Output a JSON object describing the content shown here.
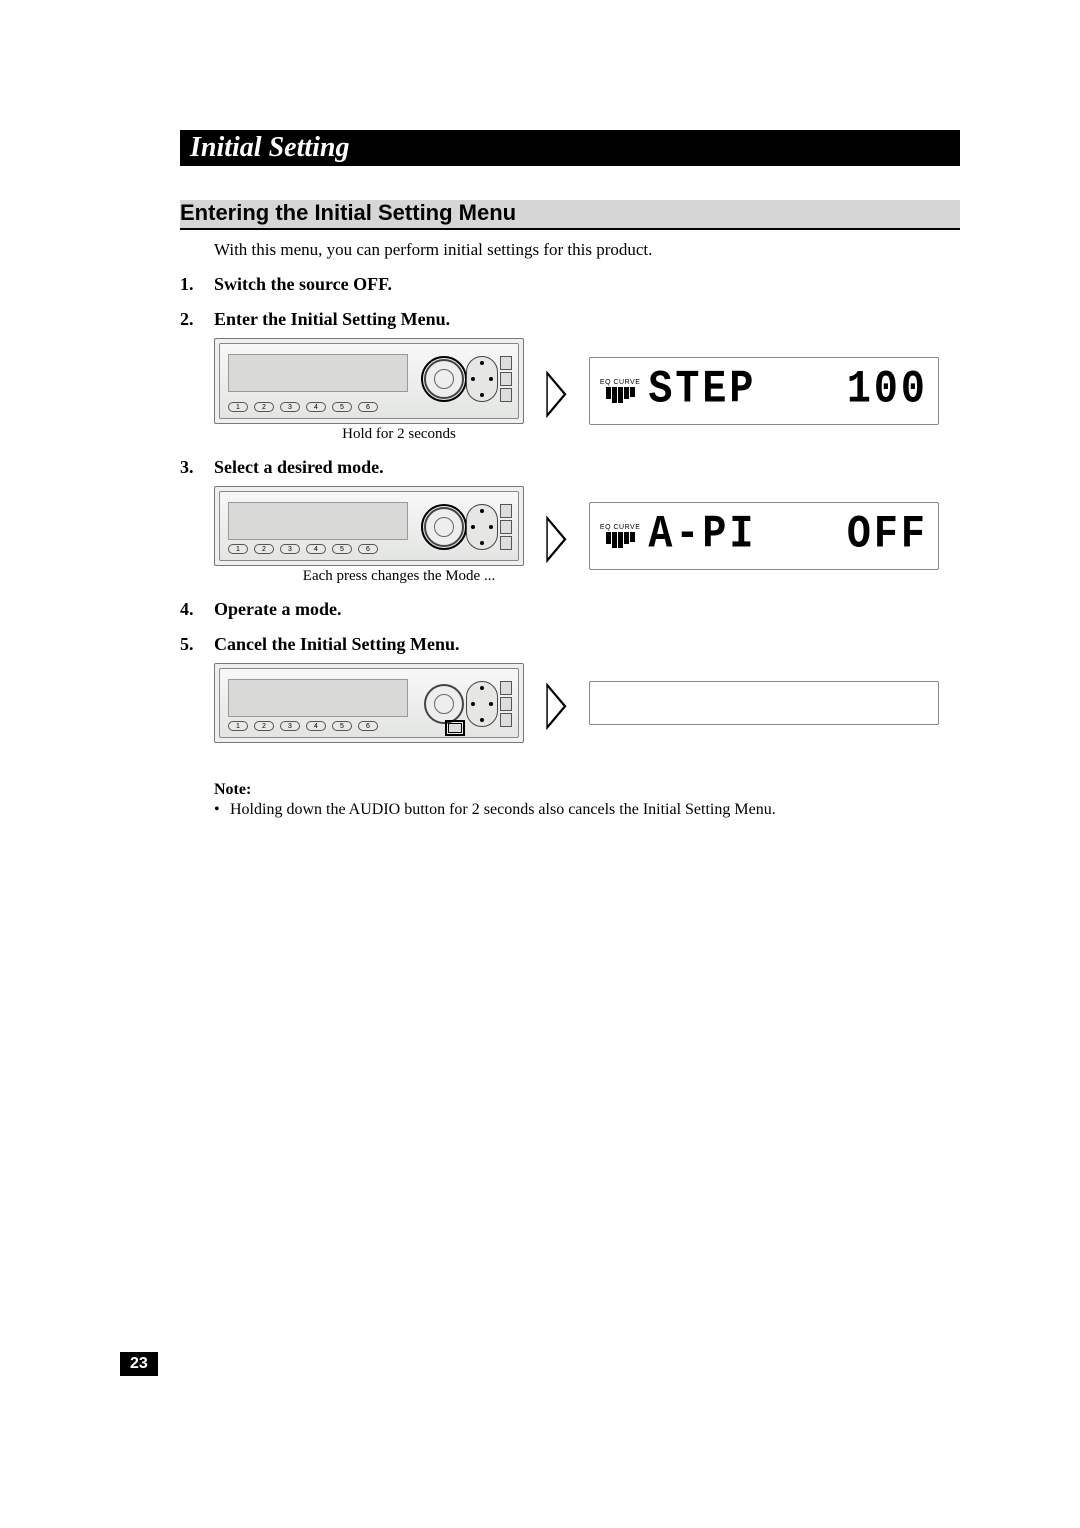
{
  "section_title": "Initial Setting",
  "subsection_title": "Entering the Initial Setting Menu",
  "intro": "With this menu, you can perform initial settings for this product.",
  "steps": [
    {
      "title": "Switch the source OFF."
    },
    {
      "title": "Enter the Initial Setting Menu.",
      "caption": "Hold for 2 seconds",
      "lcd": {
        "eq_label": "EQ CURVE",
        "text1": "STEP",
        "text2": "100"
      }
    },
    {
      "title": "Select a desired mode.",
      "caption": "Each press changes the Mode ...",
      "lcd": {
        "eq_label": "EQ CURVE",
        "text1": "A-PI",
        "text2": "OFF"
      }
    },
    {
      "title": "Operate a mode."
    },
    {
      "title": "Cancel the Initial Setting Menu."
    }
  ],
  "presets": [
    "1",
    "2",
    "3",
    "4",
    "5",
    "6"
  ],
  "note_label": "Note:",
  "note_text": "Holding down the AUDIO button for 2 seconds also cancels the Initial Setting Menu.",
  "page_number": "23"
}
